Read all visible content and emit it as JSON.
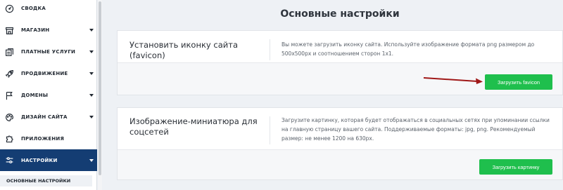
{
  "sidebar": {
    "items": [
      {
        "label": "СВОДКА",
        "icon": "gauge-icon",
        "has_caret": false
      },
      {
        "label": "МАГАЗИН",
        "icon": "shop-icon",
        "has_caret": true
      },
      {
        "label": "ПЛАТНЫЕ УСЛУГИ",
        "icon": "paid-services-icon",
        "has_caret": true
      },
      {
        "label": "ПРОДВИЖЕНИЕ",
        "icon": "rocket-icon",
        "has_caret": true
      },
      {
        "label": "ДОМЕНЫ",
        "icon": "flag-icon",
        "has_caret": true
      },
      {
        "label": "ДИЗАЙН САЙТА",
        "icon": "palette-icon",
        "has_caret": true
      },
      {
        "label": "ПРИЛОЖЕНИЯ",
        "icon": "puzzle-icon",
        "has_caret": false
      },
      {
        "label": "НАСТРОЙКИ",
        "icon": "sliders-icon",
        "has_caret": true,
        "active": true
      }
    ],
    "sub_item": "ОСНОВНЫЕ НАСТРОЙКИ",
    "active_color": "#143d73"
  },
  "main": {
    "title": "Основные настройки",
    "cards": [
      {
        "title_line1": "Установить иконку сайта",
        "title_line2": "(favicon)",
        "desc_line1": "Вы можете загрузить иконку сайта. Используйте изображение формата png размером до",
        "desc_line2": "500x500px и соотношением сторон 1x1.",
        "button": "Загрузить favicon"
      },
      {
        "title_line1": "Изображение-миниатюра для",
        "title_line2": "соцсетей",
        "desc_line1": "Загрузите картинку, которая будет отображаться в социальных сетях при упоминании ссылки",
        "desc_line2": "на главную страницу вашего сайта. Поддерживаемые форматы: jpg, png. Рекомендуемый",
        "desc_line3": "размер: не менее 1200 на 630px.",
        "button": "Загрузить картинку"
      }
    ],
    "button_color": "#1fbf4d",
    "annotation_arrow_color": "#a01818"
  }
}
